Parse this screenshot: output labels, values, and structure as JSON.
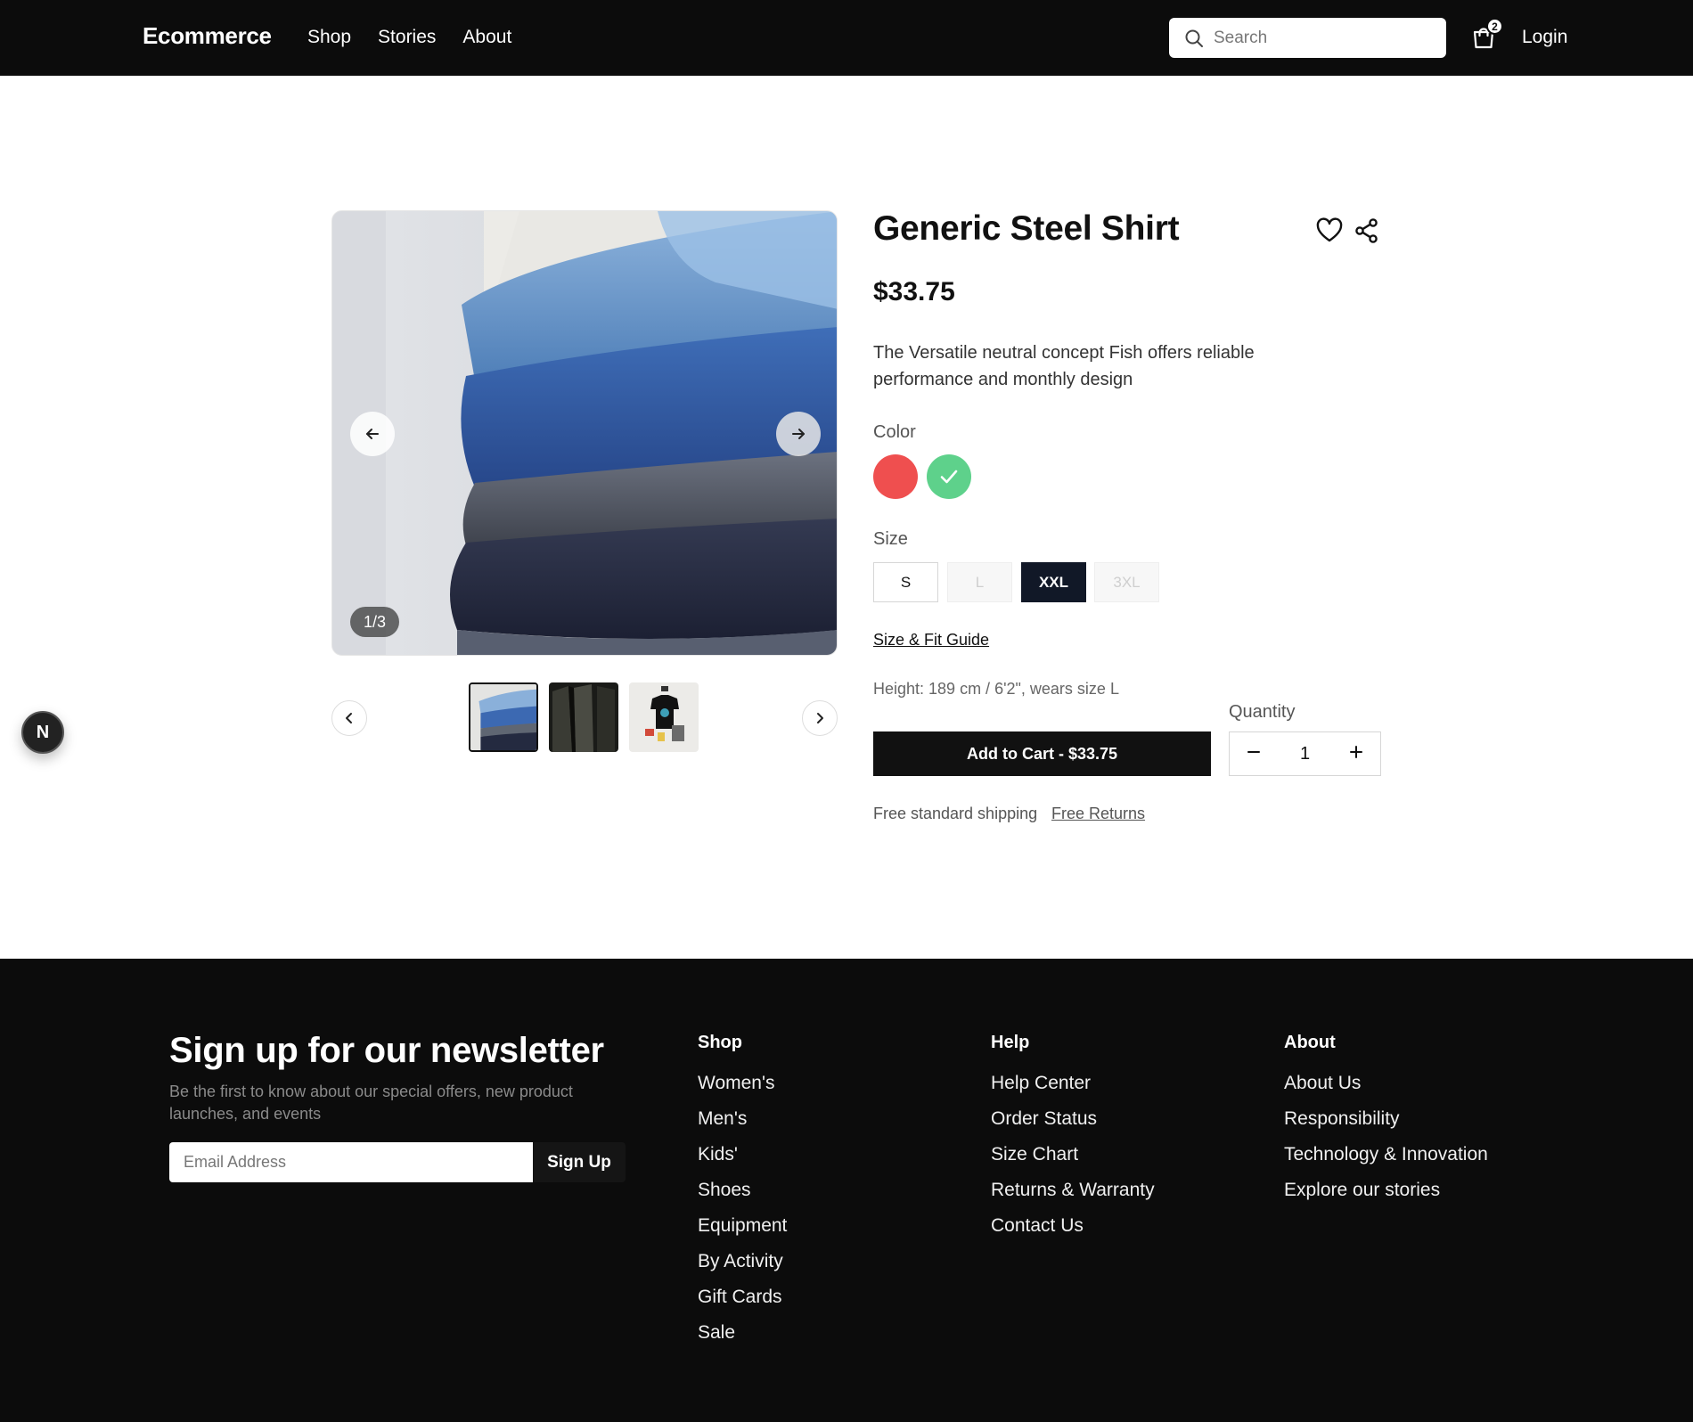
{
  "header": {
    "brand": "Ecommerce",
    "nav": [
      "Shop",
      "Stories",
      "About"
    ],
    "search_placeholder": "Search",
    "cart_count": "2",
    "login": "Login"
  },
  "gallery": {
    "counter": "1/3",
    "current": 1,
    "total": 3
  },
  "product": {
    "title": "Generic Steel Shirt",
    "price": "$33.75",
    "description": "The Versatile neutral concept Fish offers reliable performance and monthly design",
    "color_label": "Color",
    "colors": [
      {
        "name": "red",
        "hex": "#ef4f4f",
        "selected": false
      },
      {
        "name": "green",
        "hex": "#5ed18b",
        "selected": true
      }
    ],
    "size_label": "Size",
    "sizes": [
      {
        "label": "S",
        "state": "available"
      },
      {
        "label": "L",
        "state": "disabled"
      },
      {
        "label": "XXL",
        "state": "selected"
      },
      {
        "label": "3XL",
        "state": "disabled"
      }
    ],
    "size_guide": "Size & Fit Guide",
    "model_info": "Height: 189 cm / 6'2\", wears size L",
    "quantity_label": "Quantity",
    "quantity": "1",
    "add_to_cart": "Add to Cart - $33.75",
    "shipping": "Free standard shipping",
    "returns": "Free Returns"
  },
  "dev_badge": "N",
  "footer": {
    "newsletter_title": "Sign up for our newsletter",
    "newsletter_sub": "Be the first to know about our special offers, new product launches, and events",
    "email_placeholder": "Email Address",
    "signup": "Sign Up",
    "columns": [
      {
        "title": "Shop",
        "links": [
          "Women's",
          "Men's",
          "Kids'",
          "Shoes",
          "Equipment",
          "By Activity",
          "Gift Cards",
          "Sale"
        ]
      },
      {
        "title": "Help",
        "links": [
          "Help Center",
          "Order Status",
          "Size Chart",
          "Returns & Warranty",
          "Contact Us"
        ]
      },
      {
        "title": "About",
        "links": [
          "About Us",
          "Responsibility",
          "Technology & Innovation",
          "Explore our stories"
        ]
      }
    ]
  }
}
